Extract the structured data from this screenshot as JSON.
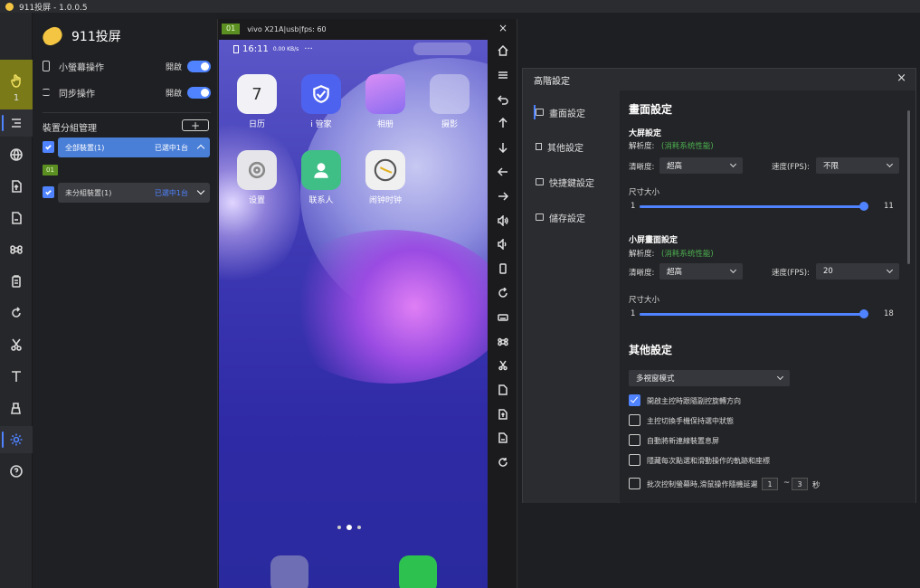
{
  "window": {
    "title": "911投屏 - 1.0.0.5"
  },
  "toolbar": {
    "count_badge": "1"
  },
  "left": {
    "brand": "911投屏",
    "small_screen_op": {
      "label": "小螢幕操作",
      "state": "開啟"
    },
    "sync_op": {
      "label": "同步操作",
      "state": "開啟"
    },
    "group_mgmt": "裝置分組管理",
    "add": "+",
    "groups": [
      {
        "name": "全部裝置(1)",
        "selected": "已選中1台"
      },
      {
        "tag": "01"
      },
      {
        "name": "未分組裝置(1)",
        "selected": "已選中1台"
      }
    ]
  },
  "phone": {
    "id": "01",
    "info": "vivo X21A|usb|fps: 60",
    "close": "×",
    "time": "16:11",
    "net": "0.00 KB/s",
    "apps": [
      {
        "name": "日历",
        "icon": "calendar-icon",
        "day": "7"
      },
      {
        "name": "i 管家",
        "icon": "shield-icon"
      },
      {
        "name": "相册",
        "icon": "gallery-icon"
      },
      {
        "name": "摄影",
        "icon": "camera-folder-icon"
      },
      {
        "name": "设置",
        "icon": "settings-icon"
      },
      {
        "name": "联系人",
        "icon": "contacts-icon"
      },
      {
        "name": "闹钟时钟",
        "icon": "clock-icon"
      }
    ]
  },
  "advanced": {
    "title": "高階設定",
    "close": "×",
    "nav": [
      {
        "label": "畫面設定"
      },
      {
        "label": "其他設定"
      },
      {
        "label": "快捷鍵設定"
      },
      {
        "label": "儲存設定"
      }
    ],
    "screen_settings": "畫面設定",
    "large": {
      "title": "大屏設定",
      "res_label": "解析度:",
      "res_value": "(消耗系统性能)",
      "clarity_label": "清晰度:",
      "clarity_value": "超高",
      "fps_label": "速度(FPS):",
      "fps_value": "不限",
      "size_label": "尺寸大小",
      "min": "1",
      "max": "11",
      "value": 11
    },
    "small": {
      "title": "小屏畫面設定",
      "res_label": "解析度:",
      "res_value": "(消耗系统性能)",
      "clarity_label": "清晰度:",
      "clarity_value": "超高",
      "fps_label": "速度(FPS):",
      "fps_value": "20",
      "size_label": "尺寸大小",
      "min": "1",
      "max": "18",
      "value": 18
    },
    "other_settings": "其他設定",
    "view_mode": "多視窗模式",
    "options": [
      {
        "label": "開啟主控時跟隨副控旋轉方向",
        "checked": true
      },
      {
        "label": "主控切換手機保持選中狀態",
        "checked": false
      },
      {
        "label": "自動將新連線裝置息屏",
        "checked": false
      },
      {
        "label": "隱藏每次點選和滑動操作的軌跡和座標",
        "checked": false
      },
      {
        "label": "批次控制螢幕時,滑鼠操作隨機延遲",
        "checked": false
      }
    ],
    "delay_min": "1",
    "delay_dash": "~",
    "delay_max": "3",
    "delay_unit": "秒"
  }
}
